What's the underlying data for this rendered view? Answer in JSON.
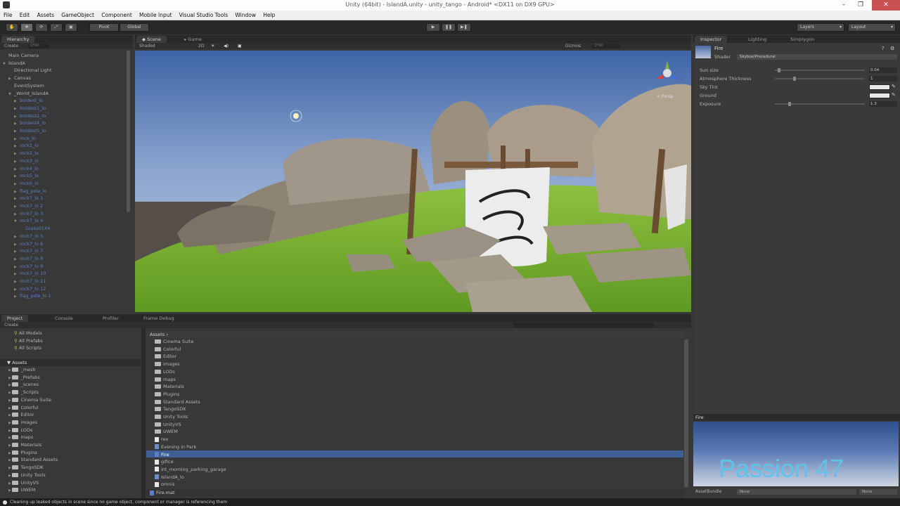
{
  "window": {
    "title": "Unity (64bit) - IslandA.unity - unity_tango - Android* <DX11 on DX9 GPU>",
    "controls": [
      "–",
      "❐",
      "✕"
    ]
  },
  "menu": [
    "File",
    "Edit",
    "Assets",
    "GameObject",
    "Component",
    "Mobile Input",
    "Visual Studio Tools",
    "Window",
    "Help"
  ],
  "toolbar": {
    "pivot": "Pivot",
    "global": "Global",
    "play_icon": "▶",
    "pause_icon": "❚❚",
    "step_icon": "▶❚",
    "layers": "Layers",
    "layout": "Layout"
  },
  "hierarchy": {
    "tab": "Hierarchy",
    "create": "Create",
    "search_placeholder": "Q*All",
    "items": [
      {
        "label": "Main Camera",
        "indent": 0,
        "blue": false,
        "arrow": ""
      },
      {
        "label": "IslandA",
        "indent": 0,
        "blue": false,
        "arrow": "▼"
      },
      {
        "label": "Directional Light",
        "indent": 1,
        "blue": false,
        "arrow": ""
      },
      {
        "label": "Canvas",
        "indent": 1,
        "blue": false,
        "arrow": "▶"
      },
      {
        "label": "EventSystem",
        "indent": 1,
        "blue": false,
        "arrow": ""
      },
      {
        "label": "_World_IslandA",
        "indent": 1,
        "blue": false,
        "arrow": "▼"
      },
      {
        "label": "boldest_lo",
        "indent": 2,
        "blue": true,
        "arrow": "▶"
      },
      {
        "label": "boldest1_lo",
        "indent": 2,
        "blue": true,
        "arrow": "▶"
      },
      {
        "label": "boldest2_lo",
        "indent": 2,
        "blue": true,
        "arrow": "▶"
      },
      {
        "label": "boldest4_lo",
        "indent": 2,
        "blue": true,
        "arrow": "▶"
      },
      {
        "label": "boldest5_lo",
        "indent": 2,
        "blue": true,
        "arrow": "▶"
      },
      {
        "label": "rock_lo",
        "indent": 2,
        "blue": true,
        "arrow": "▶"
      },
      {
        "label": "rock1_lo",
        "indent": 2,
        "blue": true,
        "arrow": "▶"
      },
      {
        "label": "rock2_lo",
        "indent": 2,
        "blue": true,
        "arrow": "▶"
      },
      {
        "label": "rock3_lo",
        "indent": 2,
        "blue": true,
        "arrow": "▶"
      },
      {
        "label": "rock4_lo",
        "indent": 2,
        "blue": true,
        "arrow": "▶"
      },
      {
        "label": "rock5_lo",
        "indent": 2,
        "blue": true,
        "arrow": "▶"
      },
      {
        "label": "rock6_lo",
        "indent": 2,
        "blue": true,
        "arrow": "▶"
      },
      {
        "label": "flag_pole_lo",
        "indent": 2,
        "blue": true,
        "arrow": "▶"
      },
      {
        "label": "rock7_lo 1",
        "indent": 2,
        "blue": true,
        "arrow": "▶"
      },
      {
        "label": "rock7_lo 2",
        "indent": 2,
        "blue": true,
        "arrow": "▶"
      },
      {
        "label": "rock7_lo 3",
        "indent": 2,
        "blue": true,
        "arrow": "▶"
      },
      {
        "label": "rock7_lo 4",
        "indent": 2,
        "blue": true,
        "arrow": "▼"
      },
      {
        "label": "Grass05X4",
        "indent": 3,
        "blue": true,
        "arrow": ""
      },
      {
        "label": "rock7_lo 5",
        "indent": 2,
        "blue": true,
        "arrow": "▶"
      },
      {
        "label": "rock7_lo 6",
        "indent": 2,
        "blue": true,
        "arrow": "▶"
      },
      {
        "label": "rock7_lo 7",
        "indent": 2,
        "blue": true,
        "arrow": "▶"
      },
      {
        "label": "rock7_lo 8",
        "indent": 2,
        "blue": true,
        "arrow": "▶"
      },
      {
        "label": "rock7_lo 9",
        "indent": 2,
        "blue": true,
        "arrow": "▶"
      },
      {
        "label": "rock7_lo 10",
        "indent": 2,
        "blue": true,
        "arrow": "▶"
      },
      {
        "label": "rock7_lo 11",
        "indent": 2,
        "blue": true,
        "arrow": "▶"
      },
      {
        "label": "rock7_lo 12",
        "indent": 2,
        "blue": true,
        "arrow": "▶"
      },
      {
        "label": "flag_pole_lo 1",
        "indent": 2,
        "blue": true,
        "arrow": "▶"
      }
    ]
  },
  "scene": {
    "tab_scene": "Scene",
    "tab_game": "Game",
    "shading": "Shaded",
    "mode_2d": "2D",
    "gizmos": "Gizmos",
    "search_placeholder": "Q*All",
    "persp": "< Persp"
  },
  "inspector": {
    "tabs": [
      "Inspector",
      "Lighting",
      "Simplygon"
    ],
    "material_name": "Fire",
    "shader_label": "Shader",
    "shader_value": "Skybox/Procedural",
    "properties": [
      {
        "label": "Sun size",
        "value": "0.04",
        "type": "slider",
        "fraction": 0.03
      },
      {
        "label": "Atmosphere Thickness",
        "value": "1",
        "type": "slider",
        "fraction": 0.2
      },
      {
        "label": "Sky Tint",
        "value": "",
        "type": "color"
      },
      {
        "label": "Ground",
        "value": "",
        "type": "color"
      },
      {
        "label": "Exposure",
        "value": "1.3",
        "type": "slider",
        "fraction": 0.15
      }
    ],
    "preview_title": "Fire",
    "watermark": "Passion 47",
    "assetbundle_label": "AssetBundle",
    "assetbundle_value": "None",
    "assetbundle_variant": "None"
  },
  "project": {
    "tabs": [
      "Project",
      "Console",
      "Profiler",
      "Frame Debug"
    ],
    "create": "Create",
    "favorites": [
      "All Models",
      "All Prefabs",
      "All Scripts"
    ],
    "assets_root": "Assets",
    "tree": [
      "_mesh",
      "_Prefabs",
      "_scenes",
      "_Scripts",
      "Cinema Suite",
      "Colorful",
      "Editor",
      "images",
      "LODs",
      "maps",
      "Materials",
      "Plugins",
      "Standard Assets",
      "TangoSDK",
      "Unity Tools",
      "UnityVS",
      "UWEM"
    ],
    "breadcrumb": "Assets ›",
    "files": [
      {
        "name": "Cinema Suite",
        "kind": "folder"
      },
      {
        "name": "Colorful",
        "kind": "folder"
      },
      {
        "name": "Editor",
        "kind": "folder"
      },
      {
        "name": "images",
        "kind": "folder"
      },
      {
        "name": "LODs",
        "kind": "folder"
      },
      {
        "name": "maps",
        "kind": "folder"
      },
      {
        "name": "Materials",
        "kind": "folder"
      },
      {
        "name": "Plugins",
        "kind": "folder"
      },
      {
        "name": "Standard Assets",
        "kind": "folder"
      },
      {
        "name": "TangoSDK",
        "kind": "folder"
      },
      {
        "name": "Unity Tools",
        "kind": "folder"
      },
      {
        "name": "UnityVS",
        "kind": "folder"
      },
      {
        "name": "UWEM",
        "kind": "folder"
      },
      {
        "name": "rex",
        "kind": "file"
      },
      {
        "name": "Evening in Park",
        "kind": "scene"
      },
      {
        "name": "Fire",
        "kind": "material"
      },
      {
        "name": "gifice",
        "kind": "file"
      },
      {
        "name": "int_morning_parking_garage",
        "kind": "file"
      },
      {
        "name": "IslandA_lo",
        "kind": "scene"
      },
      {
        "name": "omnis",
        "kind": "file"
      }
    ],
    "footer_file": "Fire.mat"
  },
  "status": "Cleaning up leaked objects in scene since no game object, component or manager is referencing them"
}
